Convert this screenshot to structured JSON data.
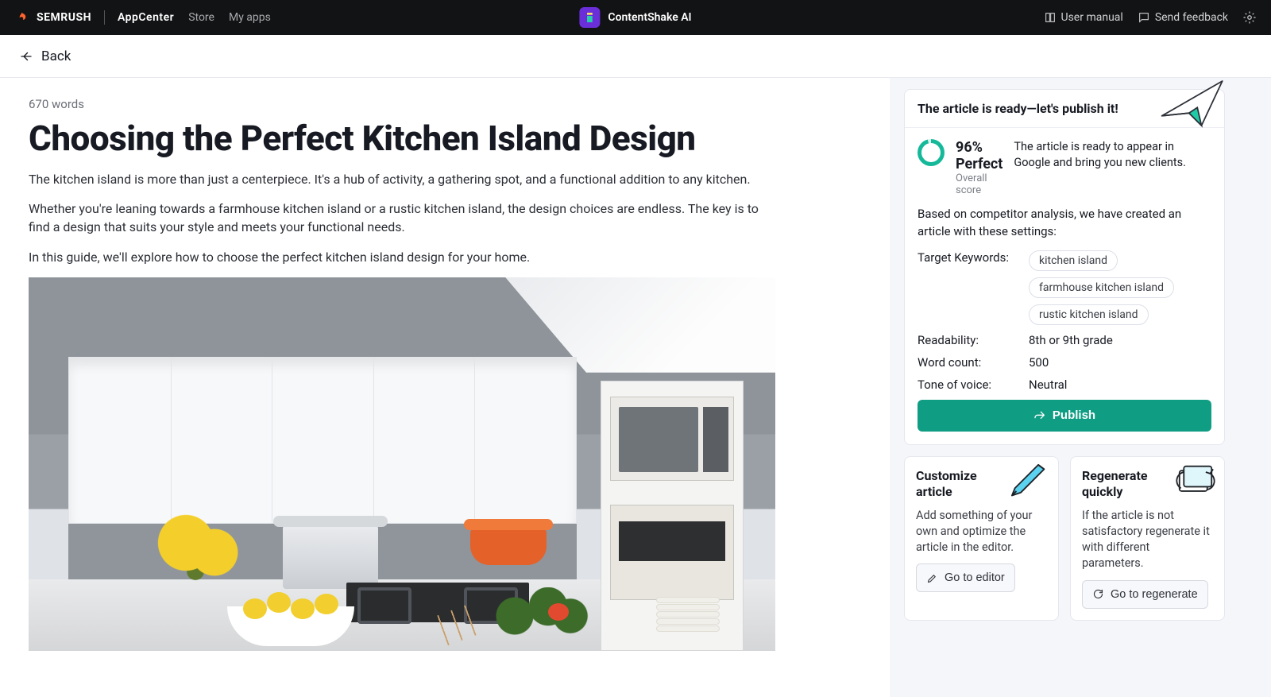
{
  "topbar": {
    "brand_main": "SEMRUSH",
    "brand_sub": "AppCenter",
    "store": "Store",
    "myapps": "My apps",
    "product": "ContentShake AI",
    "user_manual": "User manual",
    "send_feedback": "Send feedback"
  },
  "back": {
    "label": "Back"
  },
  "article": {
    "wordcount": "670 words",
    "title": "Choosing the Perfect Kitchen Island Design",
    "p1": "The kitchen island is more than just a centerpiece. It's a hub of activity, a gathering spot, and a functional addition to any kitchen.",
    "p2": "Whether you're leaning towards a farmhouse kitchen island or a rustic kitchen island, the design choices are endless. The key is to find a design that suits your style and meets your functional needs.",
    "p3": "In this guide, we'll explore how to choose the perfect kitchen island design for your home."
  },
  "panel": {
    "ready_title": "The article is ready—let's publish it!",
    "score_label": "Overall score",
    "score_pct": "96% Perfect",
    "score_desc": "The article is ready to appear in Google and bring you new clients.",
    "based": "Based on competitor analysis, we have created an article with these settings:",
    "keywords_label": "Target Keywords:",
    "keywords": [
      "kitchen island",
      "farmhouse kitchen island",
      "rustic kitchen island"
    ],
    "readability_label": "Readability:",
    "readability_value": "8th or 9th grade",
    "wordcount_label": "Word count:",
    "wordcount_value": "500",
    "tone_label": "Tone of voice:",
    "tone_value": "Neutral",
    "publish": "Publish",
    "customize_title": "Customize article",
    "customize_desc": "Add something of your own and optimize the article in the editor.",
    "customize_btn": "Go to editor",
    "regen_title": "Regenerate quickly",
    "regen_desc": "If the article is not satisfactory regenerate it with different parameters.",
    "regen_btn": "Go to regenerate"
  }
}
